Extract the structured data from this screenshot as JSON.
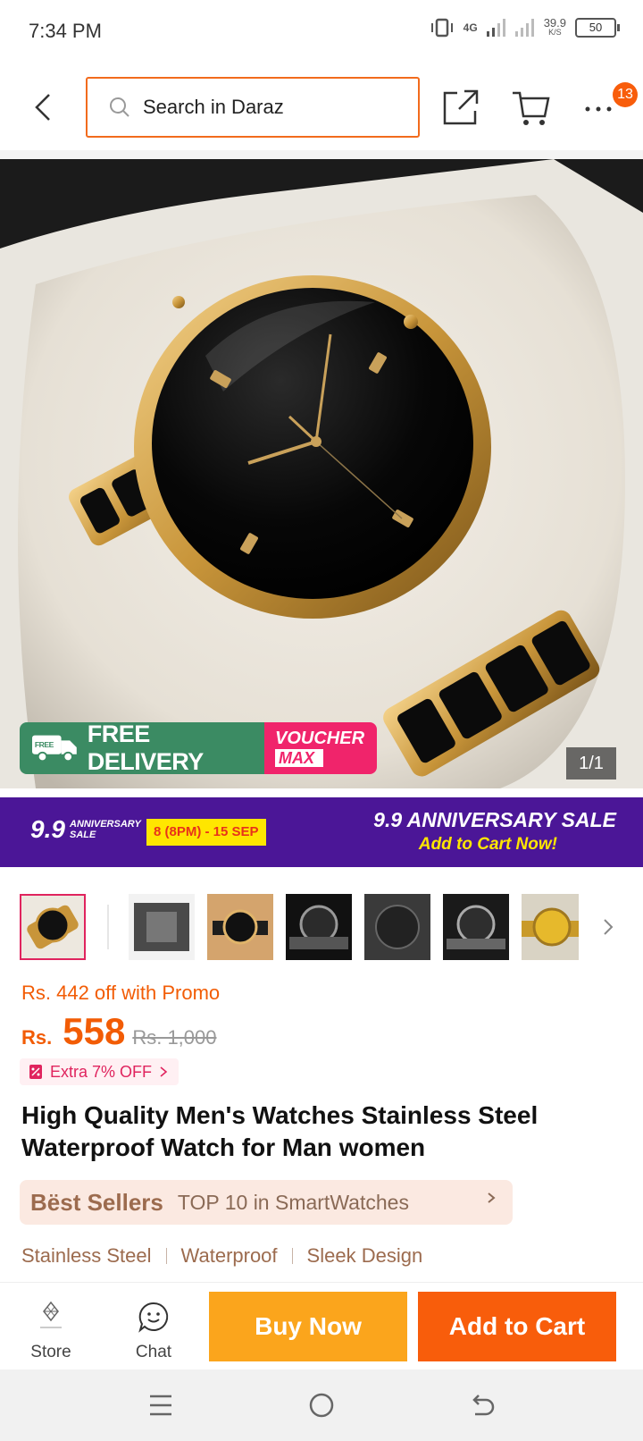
{
  "status_bar": {
    "time": "7:34 PM",
    "network": "4G",
    "speed": "39.9",
    "speed_unit": "K/S",
    "battery": "50"
  },
  "header": {
    "search_placeholder": "Search in Daraz",
    "cart_badge": "13"
  },
  "gallery": {
    "counter": "1/1",
    "free_delivery": "FREE DELIVERY",
    "free_small": "FREE",
    "voucher_line1": "VOUCHER",
    "voucher_line2": "MAX"
  },
  "sale_banner": {
    "logo_num": "9.9",
    "logo_sub": "ANNIVERSARY SALE",
    "date": "8 (8PM) - 15 SEP",
    "title": "9.9 ANNIVERSARY SALE",
    "cta": "Add to Cart Now!"
  },
  "price": {
    "promo_off": "Rs. 442 off with Promo",
    "currency": "Rs.",
    "current": "558",
    "original": "Rs. 1,000",
    "extra_off": "Extra 7% OFF"
  },
  "product": {
    "title": "High Quality Men's Watches Stainless Steel Waterproof Watch for Man women"
  },
  "best_sellers": {
    "label": "Bëst Sellers",
    "rank": "TOP 10 in SmartWatches"
  },
  "features": [
    "Stainless Steel",
    "Waterproof",
    "Sleek Design"
  ],
  "action_bar": {
    "store_label": "Store",
    "chat_label": "Chat",
    "buy_now": "Buy Now",
    "add_to_cart": "Add to Cart"
  },
  "colors": {
    "brand_orange": "#f85d0b",
    "buy_now": "#fba51c",
    "sale_purple": "#4b1697",
    "price": "#f25c05"
  }
}
